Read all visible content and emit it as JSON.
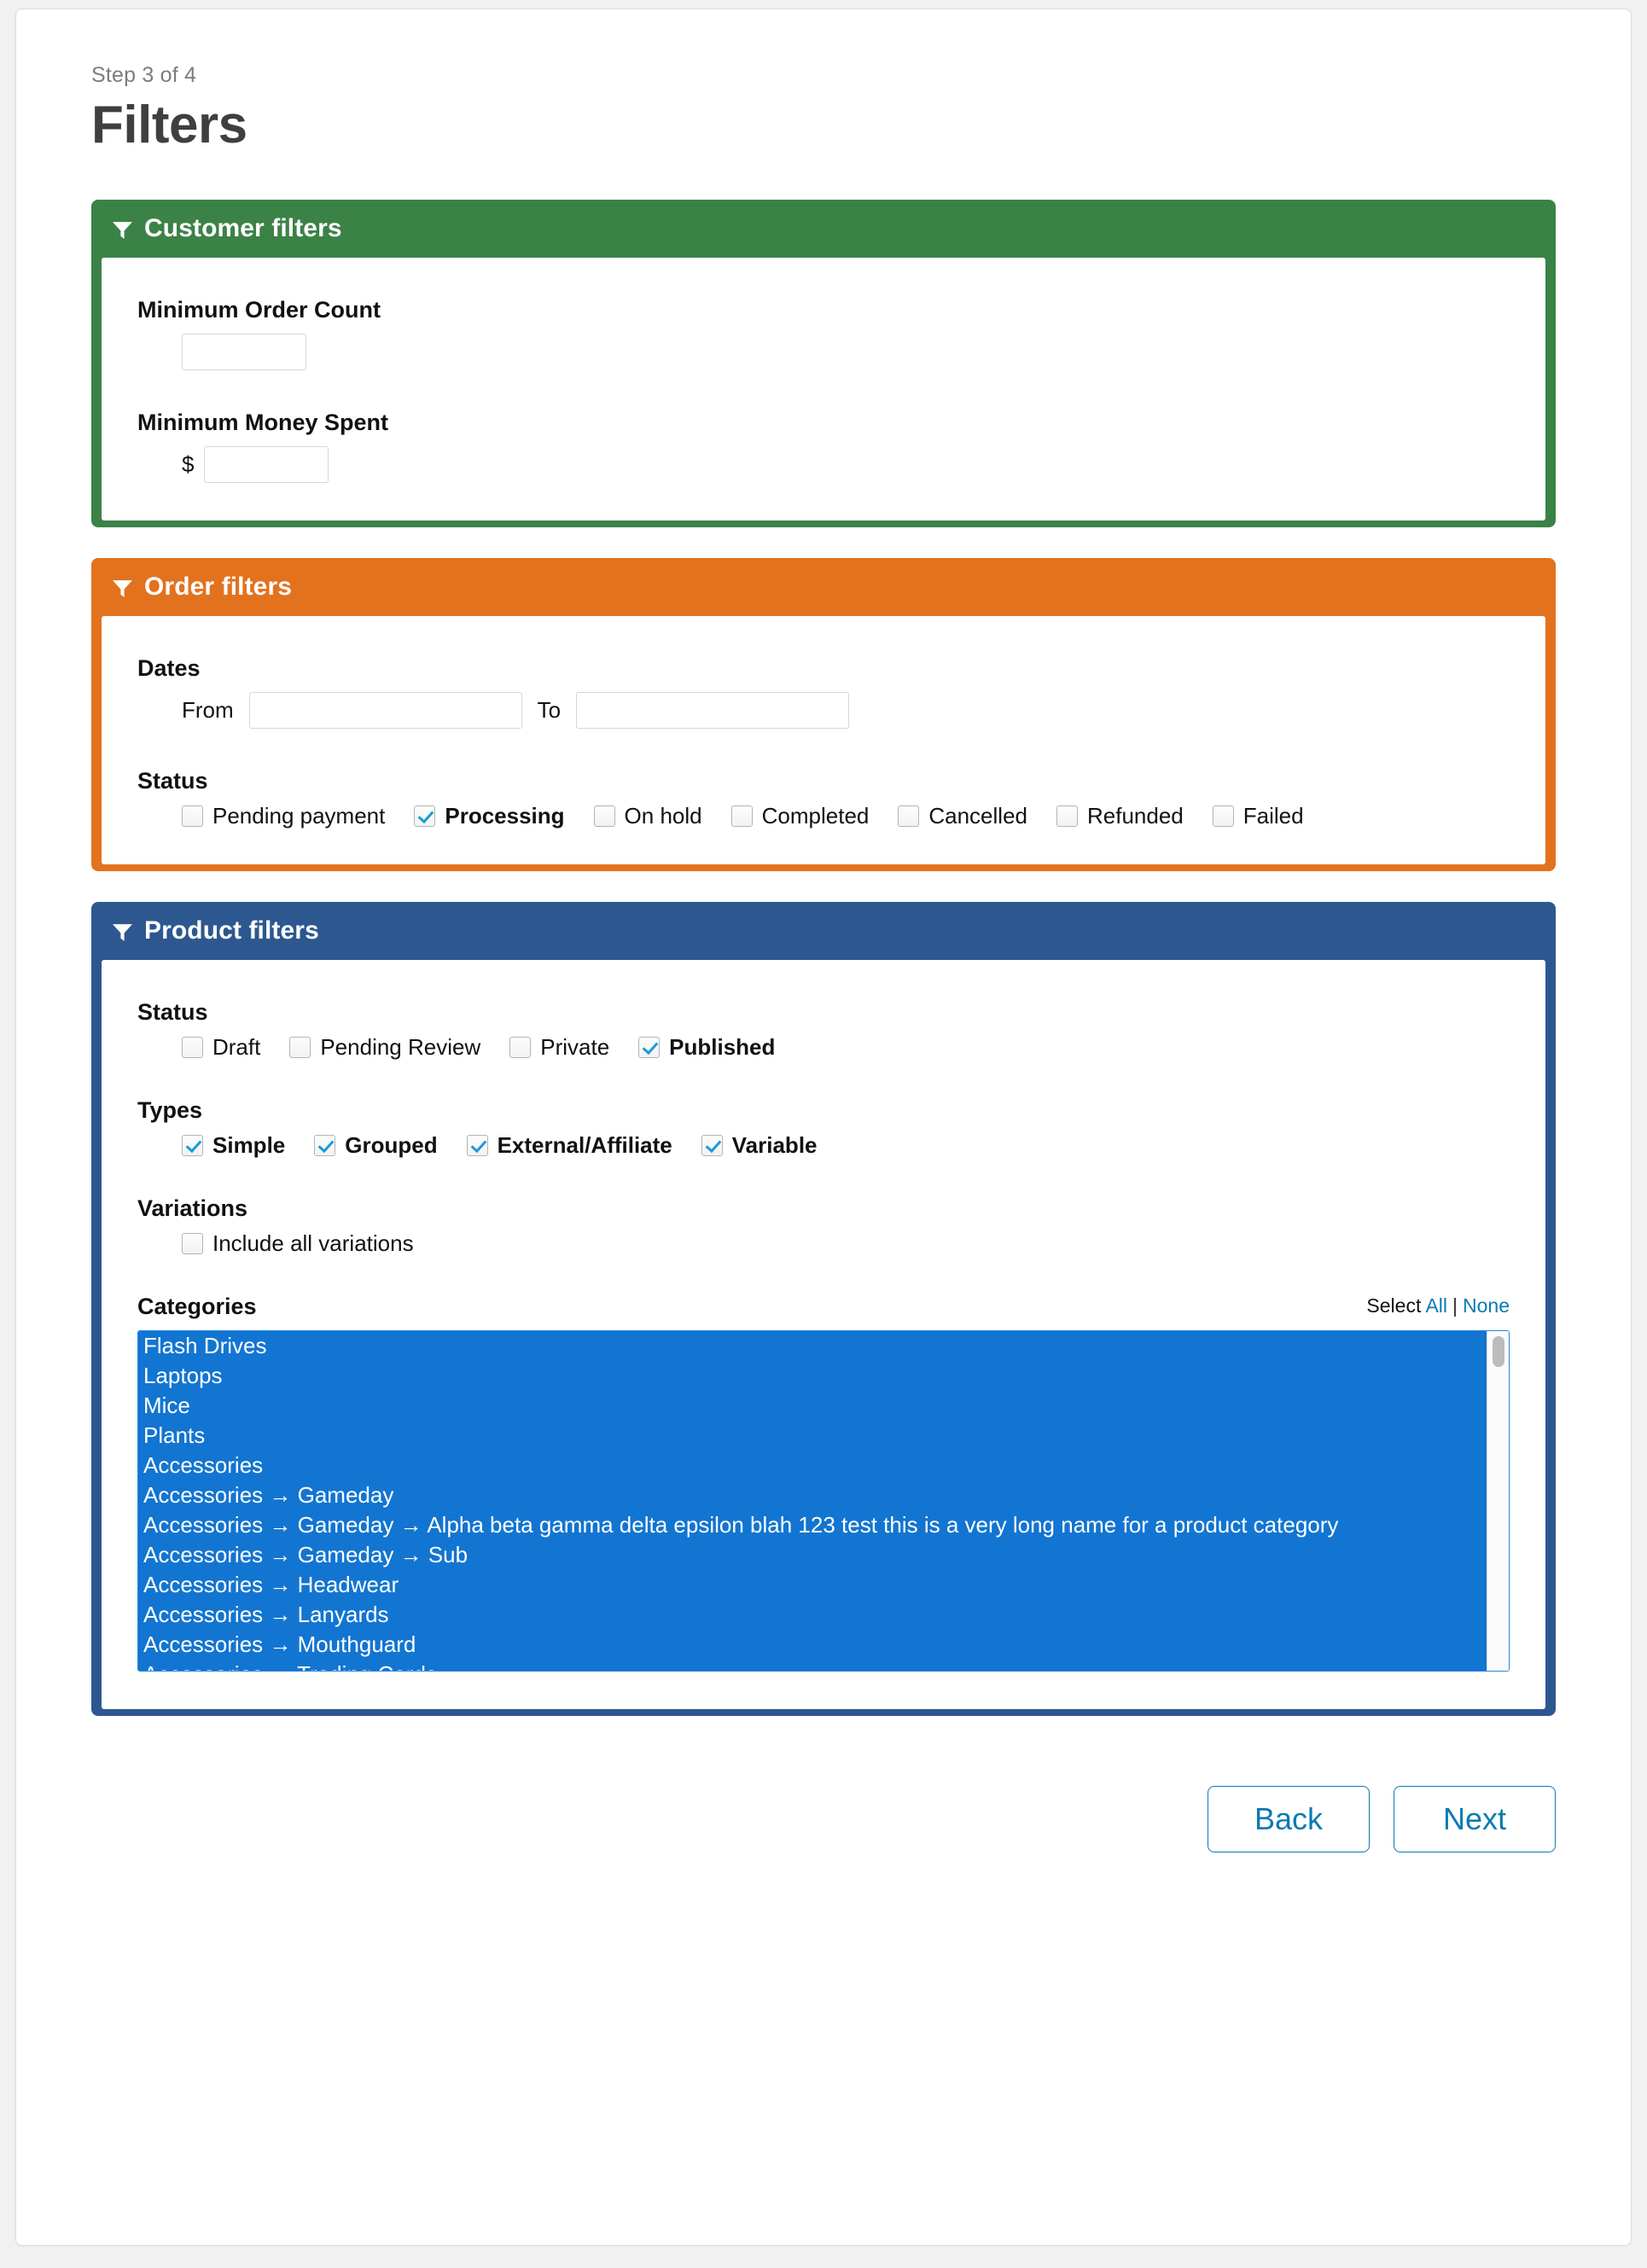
{
  "header": {
    "step": "Step 3 of 4",
    "title": "Filters"
  },
  "colors": {
    "customer": "#3b8246",
    "order": "#e2721e",
    "product": "#2c588f",
    "link": "#0b7ab3",
    "selected_option": "#1275d1",
    "checkmark": "#1b9ad6"
  },
  "customer_filters": {
    "heading": "Customer filters",
    "min_order_count": {
      "label": "Minimum Order Count",
      "value": "",
      "placeholder": ""
    },
    "min_money_spent": {
      "label": "Minimum Money Spent",
      "currency": "$",
      "value": "",
      "placeholder": ""
    }
  },
  "order_filters": {
    "heading": "Order filters",
    "dates": {
      "label": "Dates",
      "from_label": "From",
      "from_value": "",
      "to_label": "To",
      "to_value": ""
    },
    "status": {
      "label": "Status",
      "options": [
        {
          "label": "Pending payment",
          "checked": false
        },
        {
          "label": "Processing",
          "checked": true
        },
        {
          "label": "On hold",
          "checked": false
        },
        {
          "label": "Completed",
          "checked": false
        },
        {
          "label": "Cancelled",
          "checked": false
        },
        {
          "label": "Refunded",
          "checked": false
        },
        {
          "label": "Failed",
          "checked": false
        }
      ]
    }
  },
  "product_filters": {
    "heading": "Product filters",
    "status": {
      "label": "Status",
      "options": [
        {
          "label": "Draft",
          "checked": false
        },
        {
          "label": "Pending Review",
          "checked": false
        },
        {
          "label": "Private",
          "checked": false
        },
        {
          "label": "Published",
          "checked": true
        }
      ]
    },
    "types": {
      "label": "Types",
      "options": [
        {
          "label": "Simple",
          "checked": true
        },
        {
          "label": "Grouped",
          "checked": true
        },
        {
          "label": "External/Affiliate",
          "checked": true
        },
        {
          "label": "Variable",
          "checked": true
        }
      ]
    },
    "variations": {
      "label": "Variations",
      "options": [
        {
          "label": "Include all variations",
          "checked": false
        }
      ]
    },
    "categories": {
      "label": "Categories",
      "select_text": "Select",
      "select_all": "All",
      "separator": "|",
      "select_none": "None",
      "options": [
        {
          "label": "Flash Drives",
          "selected": true
        },
        {
          "label": "Laptops",
          "selected": true
        },
        {
          "label": "Mice",
          "selected": true
        },
        {
          "label": "Plants",
          "selected": true
        },
        {
          "label": "Accessories",
          "selected": true
        },
        {
          "label": "Accessories → Gameday",
          "selected": true
        },
        {
          "label": "Accessories → Gameday → Alpha beta gamma delta epsilon blah 123 test this is a very long name for a product category",
          "selected": true
        },
        {
          "label": "Accessories → Gameday → Sub",
          "selected": true
        },
        {
          "label": "Accessories → Headwear",
          "selected": true
        },
        {
          "label": "Accessories → Lanyards",
          "selected": true
        },
        {
          "label": "Accessories → Mouthguard",
          "selected": true
        },
        {
          "label": "Accessories → Trading Cards",
          "selected": true
        }
      ]
    }
  },
  "footer": {
    "back_label": "Back",
    "next_label": "Next"
  }
}
